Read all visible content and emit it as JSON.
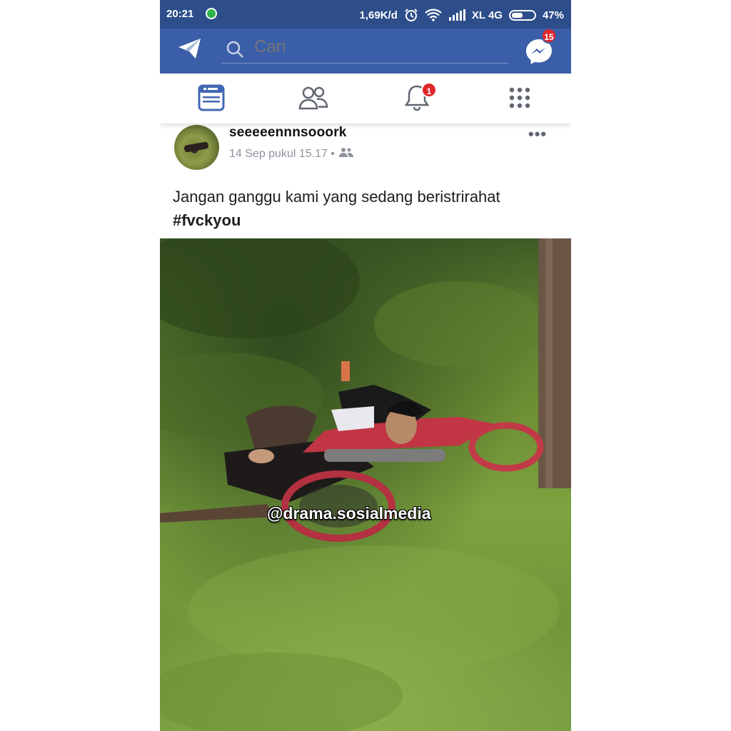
{
  "status_bar": {
    "time": "20:21",
    "speed": "1,69K/d",
    "carrier": "XL 4G",
    "battery": "47%",
    "icons": [
      "whatsapp-icon",
      "alarm-icon",
      "wifi-icon",
      "signal-icon",
      "battery-icon"
    ]
  },
  "header": {
    "search_placeholder": "Cari",
    "messenger_badge": "15",
    "bg_color": "#3b5ea8"
  },
  "tabs": {
    "items": [
      "news-feed",
      "friends",
      "notifications",
      "menu"
    ],
    "notification_badge": "1",
    "active": "news-feed"
  },
  "post": {
    "author": "seeeeennnsooork",
    "timestamp": "14 Sep pukul 15.17 •",
    "text": "Jangan ganggu kami yang sedang beristrirahat",
    "hashtag": "#fvckyou",
    "more_label": "•••"
  },
  "photo": {
    "watermark": "@drama.sosialmedia"
  }
}
